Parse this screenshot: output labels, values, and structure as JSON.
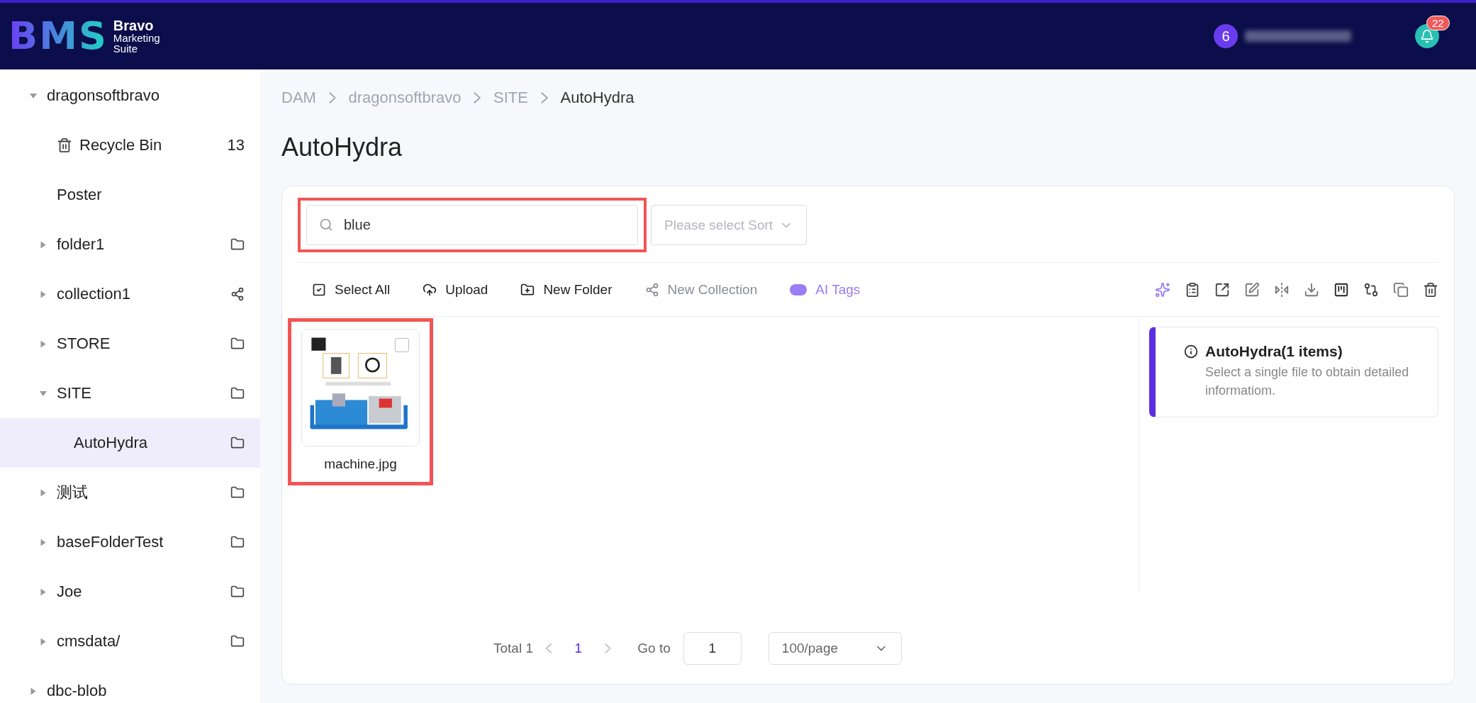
{
  "header": {
    "logo": "BMS",
    "brand_lines": [
      "Bravo",
      "Marketing",
      "Suite"
    ],
    "user": {
      "avatar": "6"
    },
    "notifications": {
      "count": "22"
    }
  },
  "sidebar": {
    "items": [
      {
        "label": "dragonsoftbravo",
        "expanded": true,
        "selected": false,
        "children": [
          {
            "label": "Recycle Bin",
            "kind": "recycle",
            "count": "13",
            "selected": false
          },
          {
            "label": "Poster",
            "selected": false
          },
          {
            "label": "folder1",
            "kind": "folder",
            "expanded": false,
            "selected": false
          },
          {
            "label": "collection1",
            "kind": "collection",
            "expanded": false,
            "selected": false
          },
          {
            "label": "STORE",
            "kind": "folder",
            "expanded": false,
            "selected": false
          },
          {
            "label": "SITE",
            "kind": "folder",
            "expanded": true,
            "selected": false,
            "children": [
              {
                "label": "AutoHydra",
                "kind": "folder",
                "selected": true
              }
            ]
          },
          {
            "label": "测试",
            "kind": "folder",
            "expanded": false,
            "selected": false
          },
          {
            "label": "baseFolderTest",
            "kind": "folder",
            "expanded": false,
            "selected": false
          },
          {
            "label": "Joe",
            "kind": "folder",
            "expanded": false,
            "selected": false
          },
          {
            "label": "cmsdata/",
            "kind": "folder",
            "expanded": false,
            "selected": false
          }
        ]
      },
      {
        "label": "dbc-blob",
        "expanded": false,
        "selected": false
      }
    ]
  },
  "breadcrumb": [
    "DAM",
    "dragonsoftbravo",
    "SITE",
    "AutoHydra"
  ],
  "page_title": "AutoHydra",
  "search": {
    "value": "blue",
    "highlighted": true
  },
  "sort": {
    "placeholder": "Please select Sort"
  },
  "toolbar": [
    {
      "label": "Select All",
      "kind": "select",
      "disabled": false
    },
    {
      "label": "Upload",
      "kind": "upload",
      "disabled": false
    },
    {
      "label": "New Folder",
      "kind": "folder",
      "disabled": false
    },
    {
      "label": "New Collection",
      "kind": "collection",
      "disabled": true
    },
    {
      "label": "AI Tags",
      "kind": "ai",
      "disabled": false
    }
  ],
  "files": [
    {
      "name": "machine.jpg",
      "checked": false,
      "highlighted": true
    }
  ],
  "info": {
    "title": "AutoHydra(1 items)",
    "text": "Select a single file to obtain detailed informatiom."
  },
  "pagination": {
    "total": "Total 1",
    "pages": [
      {
        "label": "1",
        "selected": true
      }
    ],
    "goto_label": "Go to",
    "goto_value": "1",
    "page_size": "100/page"
  }
}
